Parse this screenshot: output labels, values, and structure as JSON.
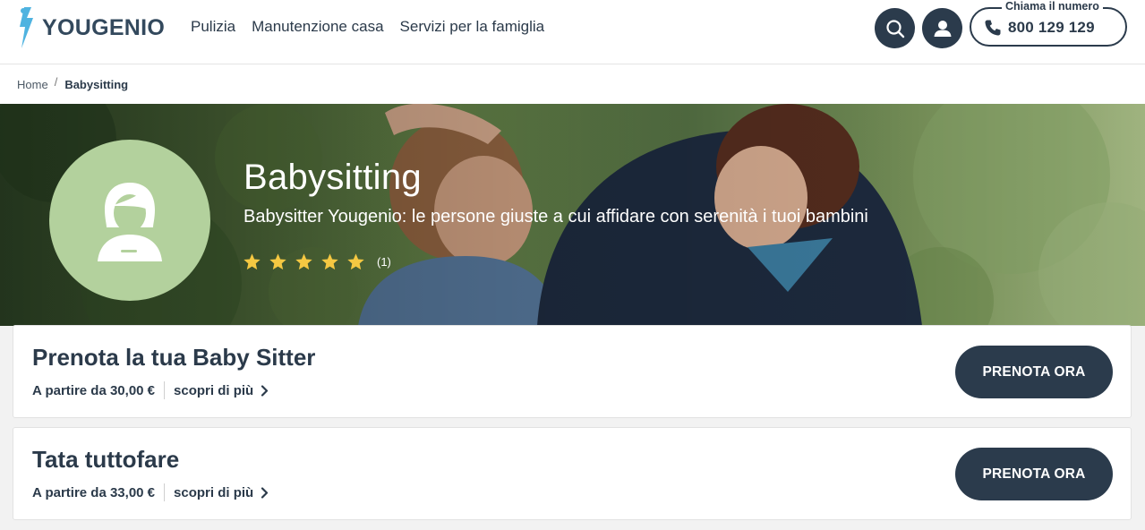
{
  "header": {
    "logo_text": "YOUGENIO",
    "nav": [
      {
        "label": "Pulizia"
      },
      {
        "label": "Manutenzione casa"
      },
      {
        "label": "Servizi per la famiglia"
      }
    ],
    "phone_caption": "Chiama il numero",
    "phone_number": "800 129 129"
  },
  "breadcrumb": {
    "home": "Home",
    "separator": "/",
    "current": "Babysitting"
  },
  "hero": {
    "title": "Babysitting",
    "subtitle": "Babysitter Yougenio: le persone giuste a cui affidare con serenità i tuoi bambini",
    "rating_stars": 5,
    "rating_count": "(1)"
  },
  "services": [
    {
      "title": "Prenota la tua Baby Sitter",
      "price": "A partire da 30,00 €",
      "more": "scopri di più",
      "button": "PRENOTA ORA"
    },
    {
      "title": "Tata tuttofare",
      "price": "A partire da 33,00 €",
      "more": "scopri di più",
      "button": "PRENOTA ORA"
    }
  ],
  "colors": {
    "brand_dark": "#2b3b4c",
    "logo_accent": "#4fb3e0",
    "avatar_bg": "#b3d19d",
    "star": "#f5c842"
  },
  "icons": {
    "search": "search-icon",
    "account": "user-icon",
    "phone": "phone-icon",
    "chevron": "chevron-right-icon",
    "star": "star-icon",
    "avatar": "nanny-avatar-icon"
  }
}
